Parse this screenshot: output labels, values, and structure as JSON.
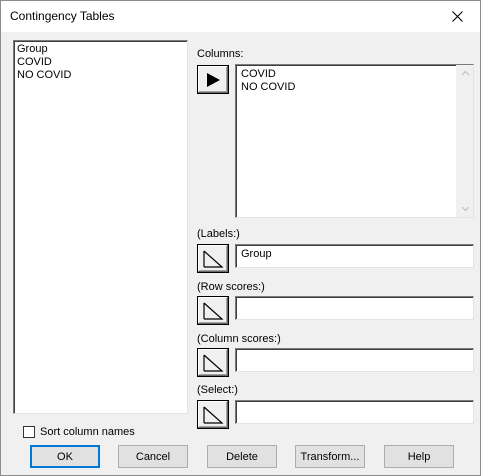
{
  "window": {
    "title": "Contingency Tables",
    "close_icon": "close-icon"
  },
  "variables": {
    "items": [
      "Group",
      "COVID",
      "NO COVID"
    ]
  },
  "columns": {
    "label": "Columns:",
    "items": [
      "COVID",
      "NO COVID"
    ]
  },
  "labels_field": {
    "label": "(Labels:)",
    "value": "Group"
  },
  "row_scores_field": {
    "label": "(Row scores:)",
    "value": ""
  },
  "column_scores_field": {
    "label": "(Column scores:)",
    "value": ""
  },
  "select_field": {
    "label": "(Select:)",
    "value": ""
  },
  "sort_checkbox": {
    "label": "Sort column names",
    "checked": false
  },
  "buttons": {
    "ok": "OK",
    "cancel": "Cancel",
    "delete": "Delete",
    "transform": "Transform...",
    "help": "Help"
  }
}
